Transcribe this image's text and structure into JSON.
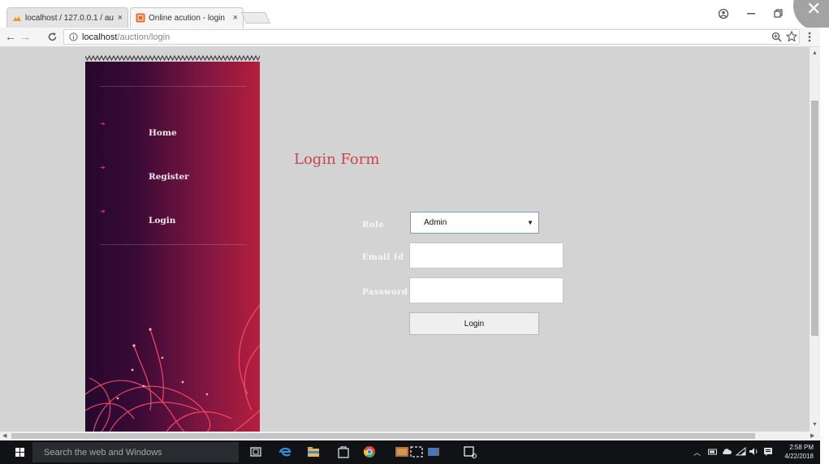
{
  "browser": {
    "tabs": [
      {
        "title": "localhost / 127.0.0.1 / au",
        "close": "×",
        "active": false
      },
      {
        "title": "Online acution - login",
        "close": "×",
        "active": true
      }
    ],
    "address": {
      "host": "localhost",
      "path": "/auction/login"
    }
  },
  "sidebar": {
    "nav": [
      {
        "label": "Home"
      },
      {
        "label": "Register"
      },
      {
        "label": "Login"
      }
    ]
  },
  "form": {
    "title": "Login Form",
    "role_label": "Role",
    "role_value": "Admin",
    "email_label": "Email Id",
    "email_value": "",
    "password_label": "Password",
    "password_value": "",
    "submit_label": "Login"
  },
  "taskbar": {
    "search_placeholder": "Search the web and Windows",
    "time": "2:58 PM",
    "date": "4/22/2018"
  },
  "colors": {
    "page_bg": "#d3d3d3",
    "title_red": "#c9464d",
    "sidebar_dark": "#26082e",
    "sidebar_red": "#b41f3e",
    "taskbar": "#111216"
  }
}
